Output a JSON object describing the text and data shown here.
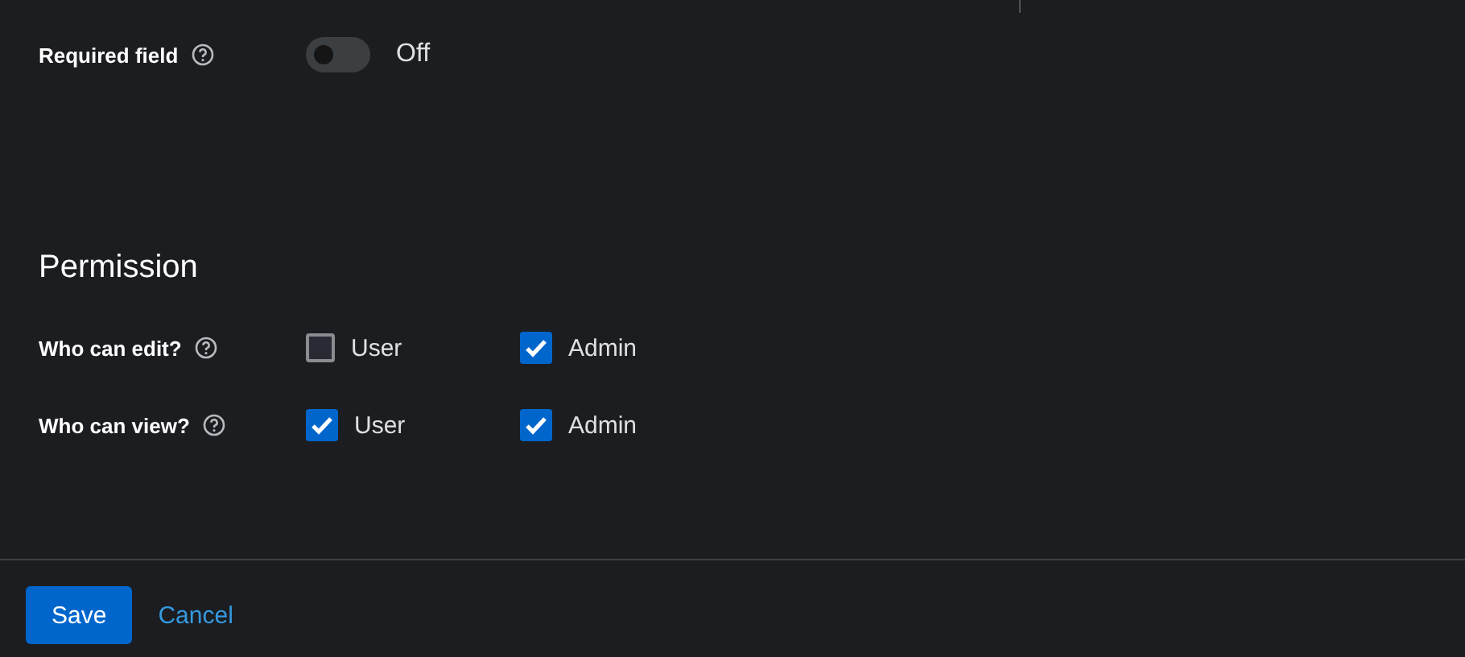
{
  "required_field": {
    "label": "Required field",
    "on": false,
    "state_text": "Off"
  },
  "permission": {
    "heading": "Permission",
    "rows": [
      {
        "label": "Who can edit?",
        "options": [
          {
            "label": "User",
            "checked": false
          },
          {
            "label": "Admin",
            "checked": true
          }
        ]
      },
      {
        "label": "Who can view?",
        "options": [
          {
            "label": "User",
            "checked": true
          },
          {
            "label": "Admin",
            "checked": true
          }
        ]
      }
    ]
  },
  "buttons": [
    {
      "label": "Save",
      "kind": "primary"
    },
    {
      "label": "Cancel",
      "kind": "link"
    }
  ]
}
